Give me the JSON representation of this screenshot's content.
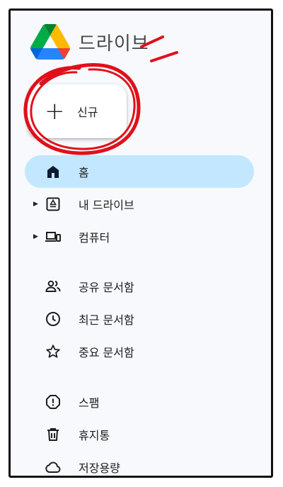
{
  "header": {
    "brand": "드라이브",
    "logo_icon": "google-drive-logo"
  },
  "new_button": {
    "label": "신규",
    "icon": "plus-icon"
  },
  "nav": {
    "items": [
      {
        "label": "홈",
        "icon": "home-icon",
        "active": true
      },
      {
        "label": "내 드라이브",
        "icon": "my-drive-icon",
        "expandable": true
      },
      {
        "label": "컴퓨터",
        "icon": "computers-icon",
        "expandable": true
      },
      {
        "label": "공유 문서함",
        "icon": "shared-people-icon"
      },
      {
        "label": "최근 문서함",
        "icon": "clock-icon"
      },
      {
        "label": "중요 문서함",
        "icon": "star-icon"
      },
      {
        "label": "스팸",
        "icon": "spam-icon"
      },
      {
        "label": "휴지통",
        "icon": "trash-icon"
      },
      {
        "label": "저장용량",
        "icon": "cloud-icon"
      }
    ]
  },
  "colors": {
    "active_bg": "#c2e7ff",
    "annotation": "#e0101a"
  }
}
